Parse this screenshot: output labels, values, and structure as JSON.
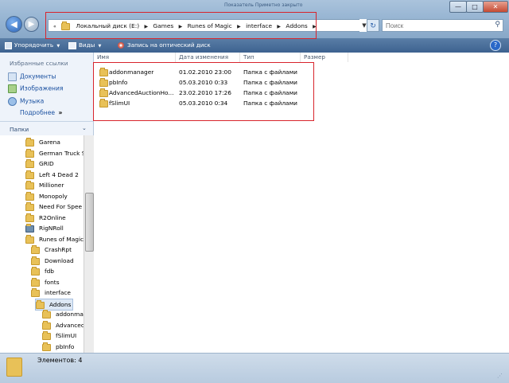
{
  "window": {
    "title_hint": "Показатель Приметно закрыто",
    "min_label": "—",
    "max_label": "□",
    "close_label": "✕"
  },
  "address": {
    "crumbs": [
      "Локальный диск (E:)",
      "Games",
      "Runes of Magic",
      "interface",
      "Addons"
    ]
  },
  "search": {
    "placeholder": "Поиск"
  },
  "toolbar": {
    "organize": "Упорядочить",
    "views": "Виды",
    "burn": "Запись на оптический диск",
    "help": "?"
  },
  "nav": {
    "favorites_header": "Избранные ссылки",
    "links": [
      "Документы",
      "Изображения",
      "Музыка"
    ],
    "more": "Подробнее",
    "folders_header": "Папки",
    "tree": [
      "Garena",
      "German Truck S",
      "GRID",
      "Left 4 Dead 2",
      "Millioner",
      "Monopoly",
      "Need For Spee",
      "R2Online",
      "RigNRoll",
      "Runes of Magic",
      "CrashRpt",
      "Download",
      "fdb",
      "fonts",
      "interface",
      "Addons",
      "addonma",
      "Advanced",
      "fSlimUI",
      "pbInfo"
    ]
  },
  "columns": [
    "Имя",
    "Дата изменения",
    "Тип",
    "Размер"
  ],
  "files": [
    {
      "name": "addonmanager",
      "date": "01.02.2010 23:00",
      "type": "Папка с файлами"
    },
    {
      "name": "pbInfo",
      "date": "05.03.2010 0:33",
      "type": "Папка с файлами"
    },
    {
      "name": "AdvancedAuctionHo...",
      "date": "23.02.2010 17:26",
      "type": "Папка с файлами"
    },
    {
      "name": "fSlimUI",
      "date": "05.03.2010 0:34",
      "type": "Папка с файлами"
    }
  ],
  "status": {
    "count": "Элементов: 4"
  },
  "colors": {
    "annotation": "#d8242c",
    "link": "#1a50a0",
    "folder": "#e8c158"
  }
}
